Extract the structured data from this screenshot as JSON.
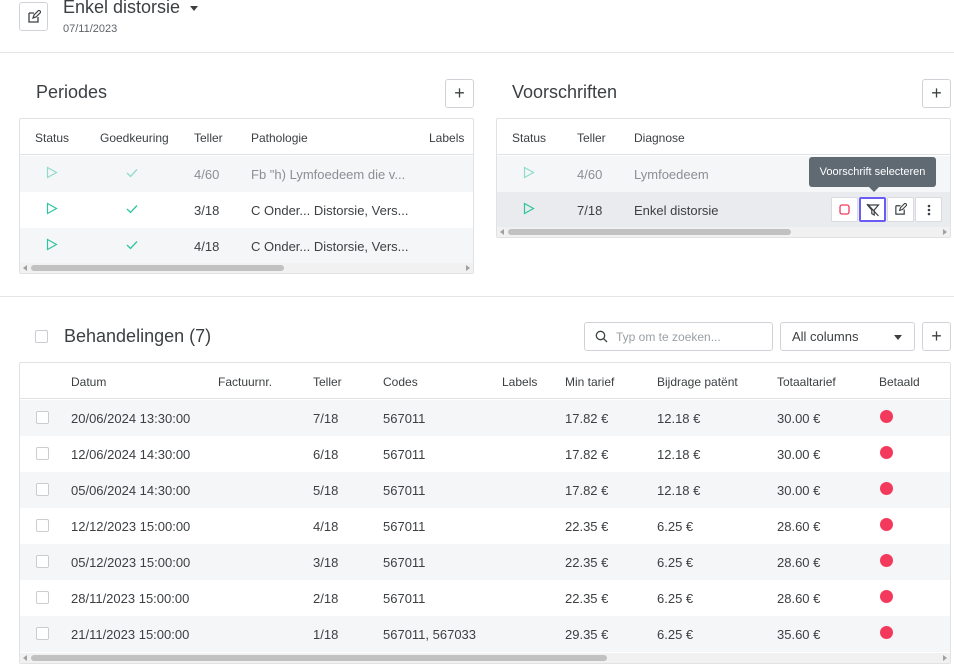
{
  "header": {
    "title": "Enkel distorsie",
    "date": "07/11/2023"
  },
  "periodes": {
    "title": "Periodes",
    "add_label": "+",
    "columns": [
      "Status",
      "Goedkeuring",
      "Teller",
      "Pathologie",
      "Labels"
    ],
    "rows": [
      {
        "teller": "4/60",
        "pathologie": "Fb \"h) Lymfoedeem die v...",
        "muted": true
      },
      {
        "teller": "3/18",
        "pathologie": "C Onder... Distorsie, Vers...",
        "muted": false
      },
      {
        "teller": "4/18",
        "pathologie": "C Onder... Distorsie, Vers...",
        "muted": false
      }
    ]
  },
  "voorschriften": {
    "title": "Voorschriften",
    "add_label": "+",
    "columns": [
      "Status",
      "Teller",
      "Diagnose"
    ],
    "rows": [
      {
        "teller": "4/60",
        "diagnose": "Lymfoedeem",
        "muted": true
      },
      {
        "teller": "7/18",
        "diagnose": "Enkel distorsie",
        "muted": false
      }
    ],
    "tooltip": "Voorschrift selecteren"
  },
  "behandelingen": {
    "title": "Behandelingen (7)",
    "search_placeholder": "Typ om te zoeken...",
    "column_filter": "All columns",
    "add_label": "+",
    "columns": [
      "Datum",
      "Factuurnr.",
      "Teller",
      "Codes",
      "Labels",
      "Min tarief",
      "Bijdrage patënt",
      "Totaaltarief",
      "Betaald"
    ],
    "rows": [
      {
        "datum": "20/06/2024 13:30:00",
        "teller": "7/18",
        "codes": "567011",
        "min": "17.82 €",
        "bijdrage": "12.18 €",
        "totaal": "30.00 €"
      },
      {
        "datum": "12/06/2024 14:30:00",
        "teller": "6/18",
        "codes": "567011",
        "min": "17.82 €",
        "bijdrage": "12.18 €",
        "totaal": "30.00 €"
      },
      {
        "datum": "05/06/2024 14:30:00",
        "teller": "5/18",
        "codes": "567011",
        "min": "17.82 €",
        "bijdrage": "12.18 €",
        "totaal": "30.00 €"
      },
      {
        "datum": "12/12/2023 15:00:00",
        "teller": "4/18",
        "codes": "567011",
        "min": "22.35 €",
        "bijdrage": "6.25 €",
        "totaal": "28.60 €"
      },
      {
        "datum": "05/12/2023 15:00:00",
        "teller": "3/18",
        "codes": "567011",
        "min": "22.35 €",
        "bijdrage": "6.25 €",
        "totaal": "28.60 €"
      },
      {
        "datum": "28/11/2023 15:00:00",
        "teller": "2/18",
        "codes": "567011",
        "min": "22.35 €",
        "bijdrage": "6.25 €",
        "totaal": "28.60 €"
      },
      {
        "datum": "21/11/2023 15:00:00",
        "teller": "1/18",
        "codes": "567011, 567033",
        "min": "29.35 €",
        "bijdrage": "6.25 €",
        "totaal": "35.60 €"
      }
    ]
  },
  "colors": {
    "accent_green": "#2ec4a0",
    "unpaid_red": "#f43a5c",
    "focus_purple": "#6b5cf6"
  }
}
